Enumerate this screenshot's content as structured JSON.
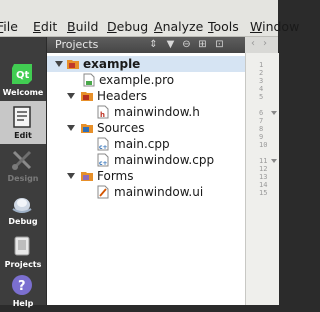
{
  "menubar": {
    "items": [
      "File",
      "Edit",
      "Build",
      "Debug",
      "Analyze",
      "Tools",
      "Window"
    ],
    "mnemonics": [
      "F",
      "E",
      "B",
      "D",
      "A",
      "T",
      "W"
    ]
  },
  "modes": [
    {
      "label": "Welcome",
      "icon": "qt-logo-icon",
      "state": "normal"
    },
    {
      "label": "Edit",
      "icon": "edit-document-icon",
      "state": "selected"
    },
    {
      "label": "Design",
      "icon": "design-tools-icon",
      "state": "disabled"
    },
    {
      "label": "Debug",
      "icon": "debug-bug-icon",
      "state": "normal"
    },
    {
      "label": "Projects",
      "icon": "projects-icon",
      "state": "normal"
    },
    {
      "label": "Help",
      "icon": "help-icon",
      "state": "normal"
    }
  ],
  "projects_panel": {
    "title": "Projects",
    "tree": [
      {
        "label": "example",
        "type": "project",
        "icon": "project-folder-icon",
        "selected": true
      },
      {
        "label": "example.pro",
        "type": "file",
        "icon": "pro-file-icon"
      },
      {
        "label": "Headers",
        "type": "folder",
        "icon": "headers-folder-icon"
      },
      {
        "label": "mainwindow.h",
        "type": "file",
        "icon": "header-file-icon"
      },
      {
        "label": "Sources",
        "type": "folder",
        "icon": "sources-folder-icon"
      },
      {
        "label": "main.cpp",
        "type": "file",
        "icon": "cpp-file-icon"
      },
      {
        "label": "mainwindow.cpp",
        "type": "file",
        "icon": "cpp-file-icon"
      },
      {
        "label": "Forms",
        "type": "folder",
        "icon": "forms-folder-icon"
      },
      {
        "label": "mainwindow.ui",
        "type": "file",
        "icon": "ui-file-icon"
      }
    ]
  },
  "editor": {
    "line_numbers": [
      "1",
      "2",
      "3",
      "4",
      "5",
      "6",
      "7",
      "8",
      "9",
      "10",
      "11",
      "12",
      "13",
      "14",
      "15"
    ]
  },
  "colors": {
    "sidebar": "#3d3d3d",
    "selected_mode": "#c7c7c7",
    "selected_row": "#d6e4f3",
    "panel_header": "#4f4f4f",
    "folder_orange": "#e7902a"
  }
}
